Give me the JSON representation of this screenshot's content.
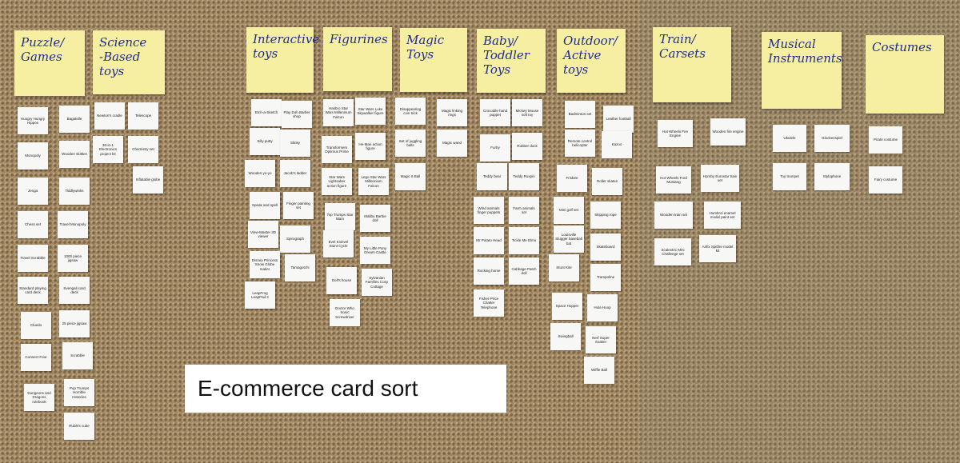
{
  "caption": "E-commerce card sort",
  "categories": [
    {
      "label": "Puzzle/\nGames"
    },
    {
      "label": "Science\n-Based toys"
    },
    {
      "label": "Interactive\ntoys"
    },
    {
      "label": "Figurines"
    },
    {
      "label": "Magic\nToys"
    },
    {
      "label": "Baby/\nToddler\nToys"
    },
    {
      "label": "Outdoor/\nActive\ntoys"
    },
    {
      "label": "Train/\nCarsets"
    },
    {
      "label": "Musical\nInstruments"
    },
    {
      "label": "Costumes"
    }
  ],
  "cards": {
    "c0": "Hungry Hungry Hippos",
    "c1": "Bagatelle",
    "c2": "Monopoly",
    "c3": "Wooden skittles",
    "c4": "Jenga",
    "c5": "Tiddlywinks",
    "c6": "Chess set",
    "c7": "Travel Monopoly",
    "c8": "Travel Scrabble",
    "c9": "1000 piece jigsaw",
    "c10": "Standard playing card deck",
    "c11": "Svengali card deck",
    "c12": "Cluedo",
    "c13": "25 piece jigsaw",
    "c14": "Connect Four",
    "c15": "Scrabble",
    "c16": "Dungeons and Dragons rulebook",
    "c17": "Pop Trumps Horrible Histories",
    "c18": "Rubik's cube",
    "c19": "Newton's cradle",
    "c20": "Telescope",
    "c21": "30-in-1 Electronics project kit",
    "c22": "Chemistry set",
    "c23": "Inflatable globe",
    "c24": "Etch-a-Sketch",
    "c25": "Play Doh Barber shop",
    "c26": "Silly putty",
    "c27": "Slinky",
    "c28": "Wooden yo-yo",
    "c29": "Jacob's ladder",
    "c30": "Speak and spell",
    "c31": "Finger painting set",
    "c32": "View-Master 3D viewer",
    "c33": "Spirograph",
    "c34": "Disney Princess Snow Globe maker",
    "c35": "Tamagotchi",
    "c36": "LeapFrog LeapPad 2",
    "c37": "Hasbro Star Wars Millennium Falcon",
    "c38": "Star Wars Luke Skywalker figure",
    "c39": "Transformers Optimus Prime",
    "c40": "He-Man action figure",
    "c41": "Star Wars Lightsaber action figure",
    "c42": "Lego Star Wars Millennium Falcon",
    "c43": "Top Trumps Star Wars",
    "c44": "Malibu Barbie doll",
    "c45": "Evel Knievel Stunt Cycle",
    "c46": "My Little Pony Dream Castle",
    "c47": "Doll's house",
    "c48": "Sylvanian Families Cosy Cottage",
    "c49": "Doctor Who Sonic Screwdriver",
    "c50": "Disappearing coin trick",
    "c51": "Magic linking rings",
    "c52": "Set of juggling balls",
    "c53": "Magic wand",
    "c54": "Magic 8 Ball",
    "c55": "Crocodile hand puppet",
    "c56": "Mickey Mouse soft toy",
    "c57": "Furby",
    "c58": "Rubber duck",
    "c59": "Teddy bear",
    "c60": "Teddy Ruxpin",
    "c61": "Wind animals finger puppets",
    "c62": "Farm animals set",
    "c63": "Mr Potato Head",
    "c64": "Tickle Me Elmo",
    "c65": "Rocking horse",
    "c66": "Cabbage Patch doll",
    "c67": "Fisher-Price Chatter Telephone",
    "c68": "Badminton set",
    "c69": "Leather football",
    "c70": "Remote control helicopter",
    "c71": "Kazoo",
    "c72": "Frisbee",
    "c73": "Roller skates",
    "c74": "Mini golf set",
    "c75": "Skipping rope",
    "c76": "Louisville Slugger baseball bat",
    "c77": "Skateboard",
    "c78": "Stunt Kite",
    "c79": "Trampoline",
    "c80": "Space Hopper",
    "c81": "Hula Hoop",
    "c82": "Swingball",
    "c83": "Nerf Super Soaker",
    "c84": "Wiffle Ball",
    "c85": "Hot Wheels Fire Engine",
    "c86": "Wooden fire engine",
    "c87": "Hot Wheels Ford Mustang",
    "c88": "Hornby Eurostar train set",
    "c89": "Wooden train set",
    "c90": "Humbrol enamel model paint set",
    "c91": "Scalextric Mini Challenge set",
    "c92": "Airfix Spitfire model kit",
    "c93": "Ukulele",
    "c94": "Glockenspiel",
    "c95": "Toy trumpet",
    "c96": "Stylophone",
    "c97": "Pirate costume",
    "c98": "Fairy costume"
  }
}
